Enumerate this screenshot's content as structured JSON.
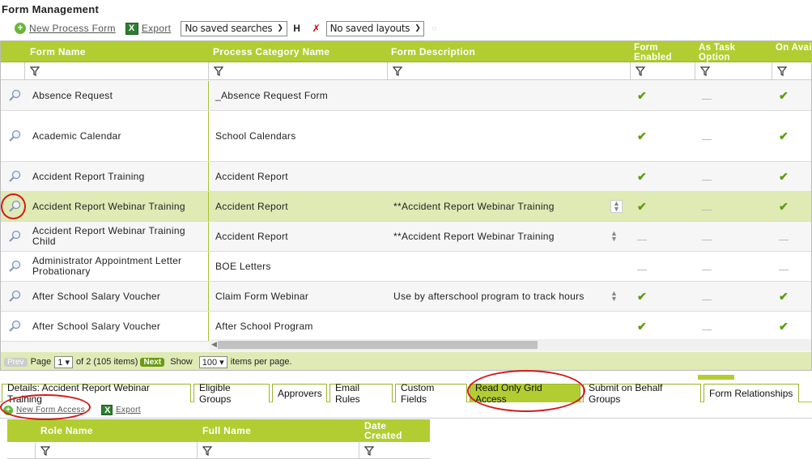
{
  "page": {
    "title": "Form Management"
  },
  "toolbar": {
    "new_process_form": "New Process Form",
    "export": "Export",
    "saved_searches": "No saved searches",
    "saved_layouts": "No saved layouts"
  },
  "grid": {
    "columns": {
      "form_name": "Form Name",
      "process_category": "Process Category Name",
      "form_description": "Form Description",
      "form_enabled": "Form Enabled",
      "as_task_option": "As Task Option",
      "on_available_forms": "On Avai Forms"
    },
    "rows": [
      {
        "name": "Absence Request",
        "category": "_Absence Request Form",
        "description": "",
        "enabled": true,
        "task": false,
        "avail": true
      },
      {
        "name": "Academic Calendar",
        "category": "School Calendars",
        "description": "",
        "enabled": true,
        "task": false,
        "avail": true
      },
      {
        "name": "Accident Report Training",
        "category": "Accident Report",
        "description": "",
        "enabled": true,
        "task": false,
        "avail": true
      },
      {
        "name": "Accident Report Webinar Training",
        "category": "Accident Report",
        "description": "**Accident Report Webinar Training",
        "enabled": true,
        "task": false,
        "avail": true
      },
      {
        "name": "Accident Report Webinar Training Child",
        "category": "Accident Report",
        "description": "**Accident Report Webinar Training",
        "enabled": false,
        "task": false,
        "avail": false
      },
      {
        "name": "Administrator Appointment Letter Probationary",
        "category": "BOE Letters",
        "description": "",
        "enabled": false,
        "task": false,
        "avail": false
      },
      {
        "name": "After School Salary Voucher",
        "category": "Claim Form Webinar",
        "description": "Use by afterschool program to track hours",
        "enabled": true,
        "task": false,
        "avail": true
      },
      {
        "name": "After School Salary Voucher",
        "category": "After School Program",
        "description": "",
        "enabled": true,
        "task": false,
        "avail": true
      }
    ]
  },
  "pager": {
    "prev": "Prev",
    "page_label": "Page",
    "page_value": "1",
    "of_text": "of 2",
    "items_text": "(105 items)",
    "next": "Next",
    "show_label": "Show",
    "per_page_value": "100",
    "per_page_suffix": "items per page."
  },
  "tabs": [
    "Details: Accident Report Webinar Training",
    "Eligible Groups",
    "Approvers",
    "Email Rules",
    "Custom Fields",
    "Read Only Grid Access",
    "Submit on Behalf Groups",
    "Form Relationships"
  ],
  "sub_toolbar": {
    "new_form_access": "New Form Access",
    "export": "Export"
  },
  "sub_grid": {
    "columns": {
      "role_name": "Role Name",
      "full_name": "Full Name",
      "date_created": "Date Created"
    }
  },
  "colors": {
    "accent": "#b2cd32",
    "selected_row": "#dfeab5",
    "annotation": "#d31b1b"
  }
}
